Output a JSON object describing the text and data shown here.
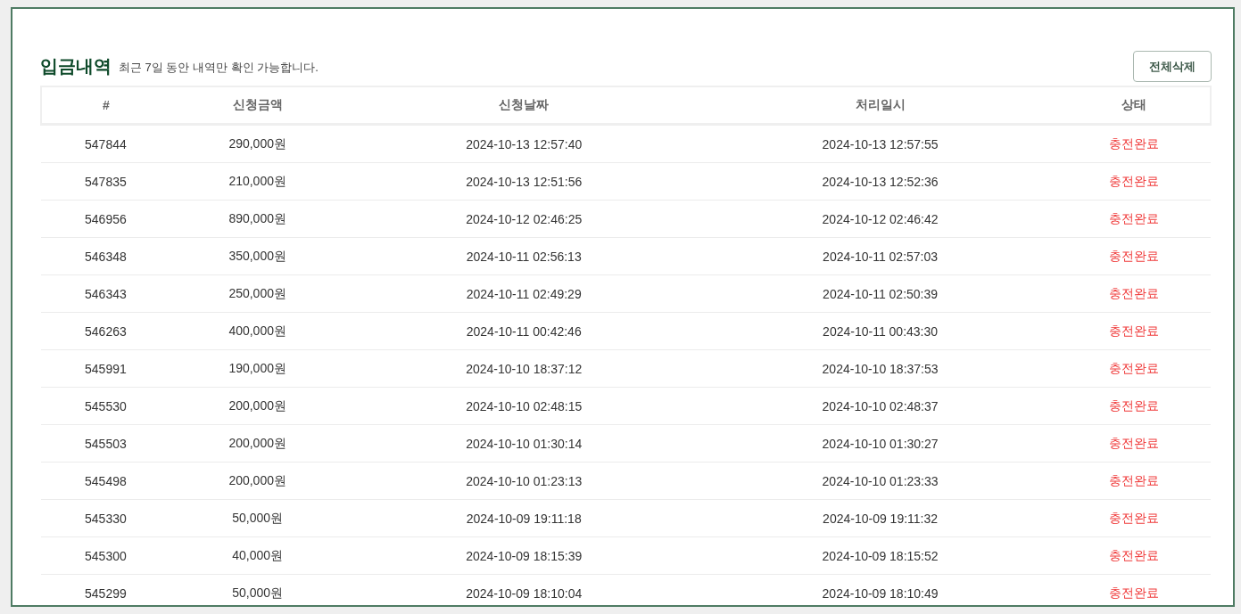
{
  "title": "입금내역",
  "subtitle": "최근 7일 동안 내역만 확인 가능합니다.",
  "delete_all_button": "전체삭제",
  "table": {
    "columns": [
      "#",
      "신청금액",
      "신청날짜",
      "처리일시",
      "상태"
    ],
    "rows": [
      [
        "547844",
        "290,000원",
        "2024-10-13 12:57:40",
        "2024-10-13 12:57:55",
        "충전완료"
      ],
      [
        "547835",
        "210,000원",
        "2024-10-13 12:51:56",
        "2024-10-13 12:52:36",
        "충전완료"
      ],
      [
        "546956",
        "890,000원",
        "2024-10-12 02:46:25",
        "2024-10-12 02:46:42",
        "충전완료"
      ],
      [
        "546348",
        "350,000원",
        "2024-10-11 02:56:13",
        "2024-10-11 02:57:03",
        "충전완료"
      ],
      [
        "546343",
        "250,000원",
        "2024-10-11 02:49:29",
        "2024-10-11 02:50:39",
        "충전완료"
      ],
      [
        "546263",
        "400,000원",
        "2024-10-11 00:42:46",
        "2024-10-11 00:43:30",
        "충전완료"
      ],
      [
        "545991",
        "190,000원",
        "2024-10-10 18:37:12",
        "2024-10-10 18:37:53",
        "충전완료"
      ],
      [
        "545530",
        "200,000원",
        "2024-10-10 02:48:15",
        "2024-10-10 02:48:37",
        "충전완료"
      ],
      [
        "545503",
        "200,000원",
        "2024-10-10 01:30:14",
        "2024-10-10 01:30:27",
        "충전완료"
      ],
      [
        "545498",
        "200,000원",
        "2024-10-10 01:23:13",
        "2024-10-10 01:23:33",
        "충전완료"
      ],
      [
        "545330",
        "50,000원",
        "2024-10-09 19:11:18",
        "2024-10-09 19:11:32",
        "충전완료"
      ],
      [
        "545300",
        "40,000원",
        "2024-10-09 18:15:39",
        "2024-10-09 18:15:52",
        "충전완료"
      ],
      [
        "545299",
        "50,000원",
        "2024-10-09 18:10:04",
        "2024-10-09 18:10:49",
        "충전완료"
      ]
    ]
  }
}
